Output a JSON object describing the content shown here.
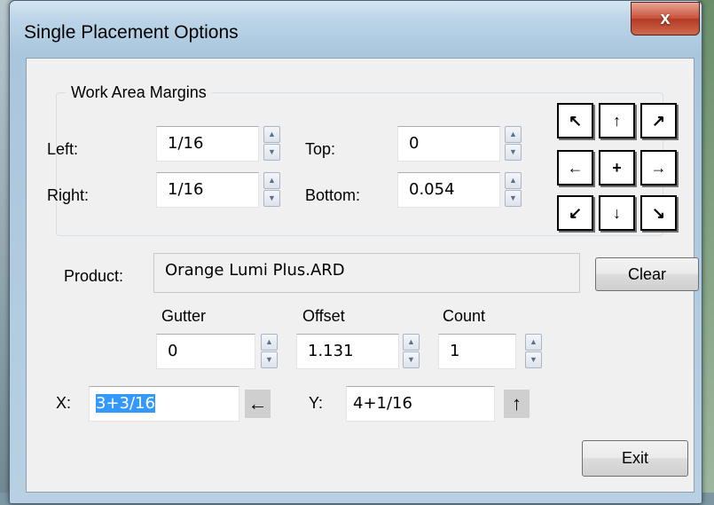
{
  "window": {
    "title": "Single Placement Options",
    "close_glyph": "x"
  },
  "margins": {
    "group_title": "Work Area Margins",
    "left_label": "Left:",
    "left_value": "1/16",
    "top_label": "Top:",
    "top_value": "0",
    "right_label": "Right:",
    "right_value": "1/16",
    "bottom_label": "Bottom:",
    "bottom_value": "0.054"
  },
  "position_pad": {
    "top_left": "↖",
    "up": "↑",
    "top_right": "↗",
    "left": "←",
    "center": "+",
    "right": "→",
    "bottom_left": "↙",
    "down": "↓",
    "bottom_right": "↘"
  },
  "product": {
    "label": "Product:",
    "value": "Orange Lumi Plus.ARD",
    "clear_label": "Clear"
  },
  "spacing": {
    "gutter_label": "Gutter",
    "gutter_value": "0",
    "offset_label": "Offset",
    "offset_value": "1.131",
    "count_label": "Count",
    "count_value": "1"
  },
  "coords": {
    "x_label": "X:",
    "x_value": "3+3/16",
    "x_arrow": "←",
    "y_label": "Y:",
    "y_value": "4+1/16",
    "y_arrow": "↑"
  },
  "footer": {
    "exit_label": "Exit"
  },
  "spinner": {
    "up": "▲",
    "down": "▼"
  }
}
